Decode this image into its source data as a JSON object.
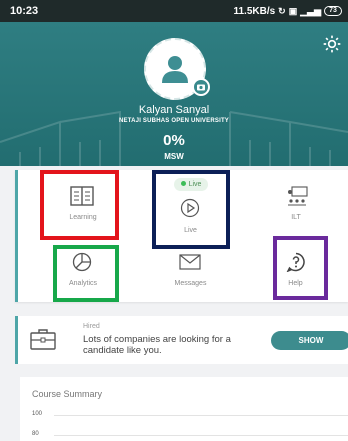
{
  "status_bar": {
    "time": "10:23",
    "speed": "11.5KB/s",
    "battery": "73"
  },
  "profile": {
    "name": "Kalyan Sanyal",
    "university": "NETAJI SUBHAS OPEN UNIVERSITY",
    "progress": "0%",
    "course": "MSW"
  },
  "menu": {
    "learning": "Learning",
    "live_badge": "Live",
    "live": "Live",
    "ilt": "ILT",
    "analytics": "Analytics",
    "messages": "Messages",
    "help": "Help"
  },
  "highlight_colors": {
    "learning": "#e3141b",
    "live": "#0c1f57",
    "analytics": "#17a84a",
    "help": "#6a2a9c"
  },
  "hired": {
    "tag": "Hired",
    "text": "Lots of companies are looking for a candidate like you.",
    "button": "SHOW"
  },
  "summary": {
    "title": "Course Summary",
    "ticks": [
      "100",
      "80"
    ]
  },
  "accent_color": "#2f7e82"
}
